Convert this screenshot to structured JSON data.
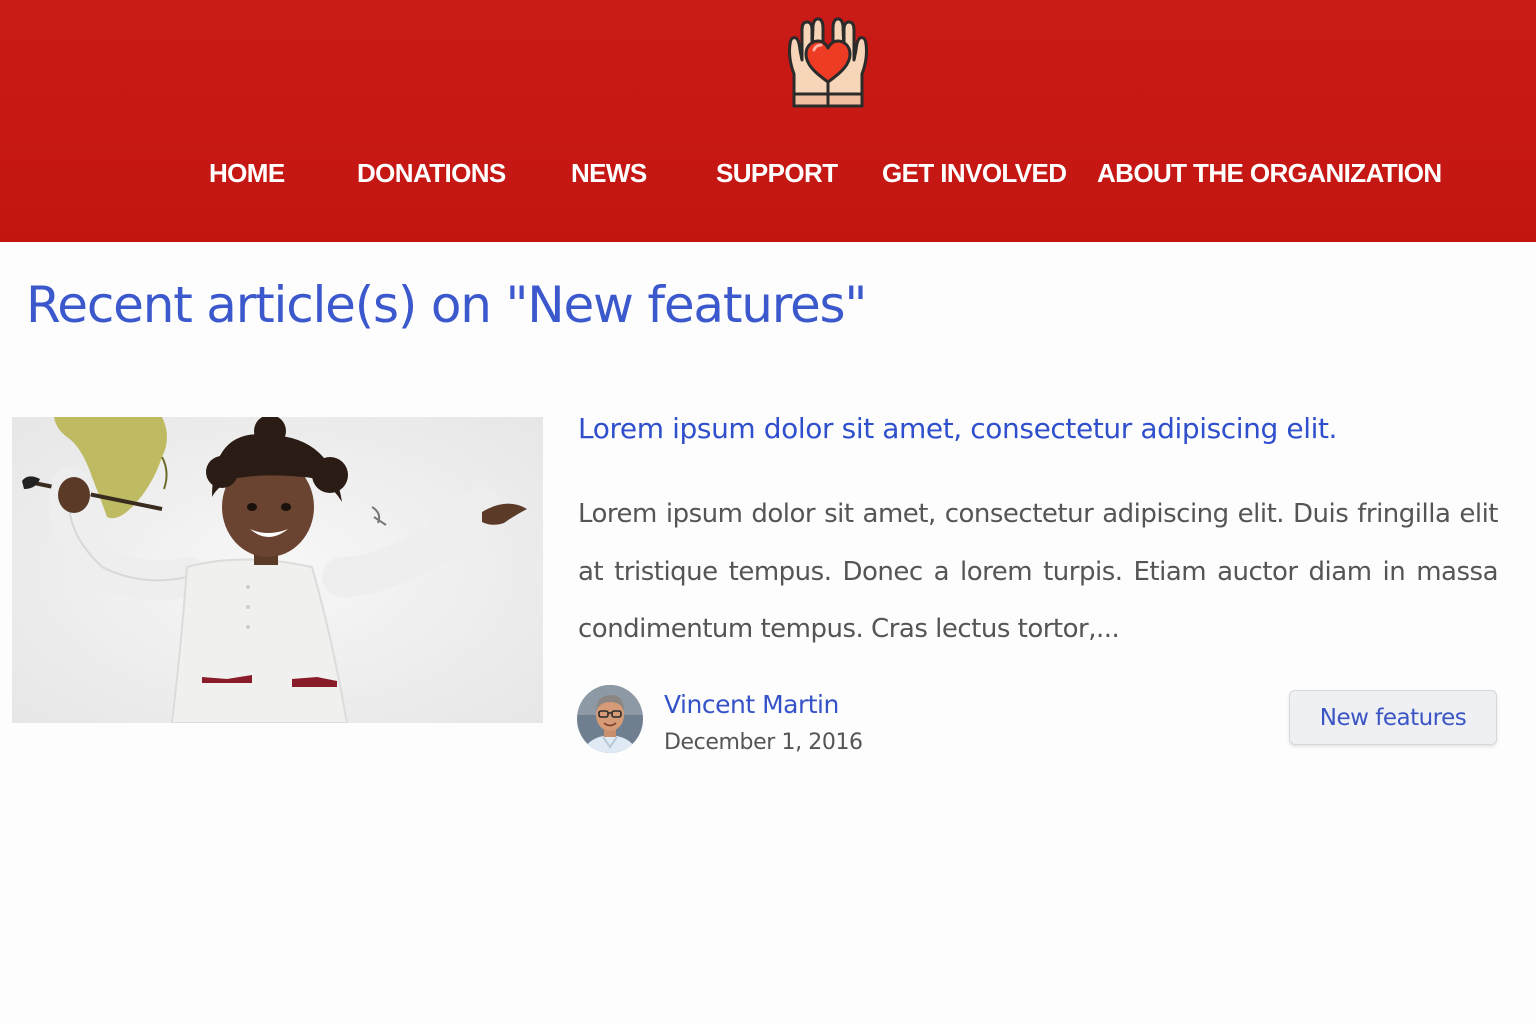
{
  "colors": {
    "header_background": "#c71814",
    "nav_text": "#ffffff",
    "heading_blue": "#3b59cc",
    "link_blue": "#2f4fcc",
    "body_text": "#555555",
    "tag_background": "#eef0f3"
  },
  "header": {
    "logo_icon": "hands-holding-heart-icon",
    "nav": [
      {
        "label": "HOME"
      },
      {
        "label": "DONATIONS"
      },
      {
        "label": "NEWS"
      },
      {
        "label": "SUPPORT"
      },
      {
        "label": "GET INVOLVED"
      },
      {
        "label": "ABOUT THE ORGANIZATION"
      }
    ]
  },
  "page": {
    "title": "Recent article(s) on \"New features\""
  },
  "articles": [
    {
      "title": "Lorem ipsum dolor sit amet, consectetur adipiscing elit.",
      "excerpt": "Lorem ipsum dolor sit amet, consectetur adipiscing elit. Duis fringilla elit at tristique tempus. Donec a lorem turpis. Etiam auctor diam in massa condimentum tempus. Cras lectus tortor,...",
      "author": "Vincent Martin",
      "date": "December 1, 2016",
      "tag": "New features"
    }
  ]
}
